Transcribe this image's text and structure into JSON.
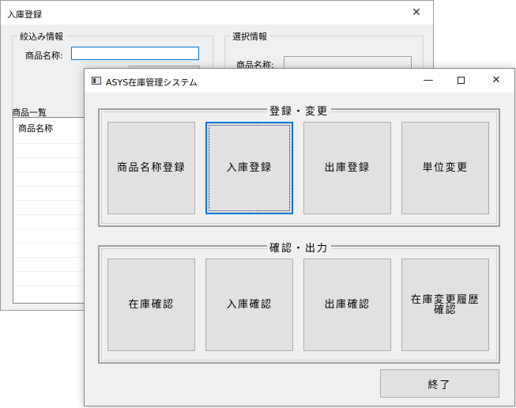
{
  "back_window": {
    "title": "入庫登録",
    "close_glyph": "✕",
    "filter_group": {
      "legend": "絞込み情報",
      "product_name_label": "商品名称:",
      "product_name_value": ""
    },
    "selection_group": {
      "legend": "選択情報",
      "product_name_label": "商品名称:"
    },
    "product_list": {
      "label": "商品一覧",
      "column_header": "商品名称"
    }
  },
  "front_window": {
    "title": "ASYS在庫管理システム",
    "minimize_glyph": "—",
    "close_glyph": "✕",
    "register_group": {
      "legend": "登録・変更",
      "buttons": [
        "商品名称登録",
        "入庫登録",
        "出庫登録",
        "単位変更"
      ]
    },
    "confirm_group": {
      "legend": "確認・出力",
      "buttons": [
        "在庫確認",
        "入庫確認",
        "出庫確認",
        "在庫変更履歴確認"
      ]
    },
    "exit_label": "終了",
    "focus_color": "#0078d7"
  }
}
